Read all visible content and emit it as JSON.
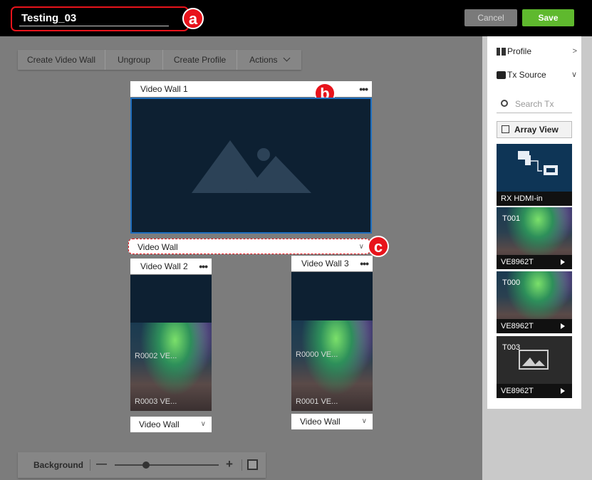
{
  "header": {
    "title": "Testing_03",
    "cancel_label": "Cancel",
    "save_label": "Save"
  },
  "callouts": {
    "a": "a",
    "b": "b",
    "c": "c"
  },
  "toolbar": {
    "items": [
      "Create Video Wall",
      "Ungroup",
      "Create Profile",
      "Actions"
    ]
  },
  "main_wall": {
    "title": "Video Wall 1",
    "menu": "•••",
    "select_value": "Video Wall"
  },
  "wall2": {
    "title": "Video Wall 2",
    "menu": "•••",
    "label_top": "R0002 VE...",
    "label_bottom": "R0003 VE...",
    "select_value": "Video Wall"
  },
  "wall3": {
    "title": "Video Wall 3",
    "menu": "•••",
    "label_top": "R0000 VE...",
    "label_bottom": "R0001 VE...",
    "select_value": "Video Wall"
  },
  "bottombar": {
    "label": "Background",
    "minus": "—",
    "plus": "+",
    "slider_level": 0.3
  },
  "right_panel": {
    "profile_label": "Profile",
    "tx_source_label": "Tx Source",
    "search_placeholder": "Search Tx",
    "array_view_label": "Array View",
    "tiles": [
      {
        "caption": "RX HDMI-in"
      },
      {
        "id": "T001",
        "caption": "VE8962T"
      },
      {
        "id": "T000",
        "caption": "VE8962T"
      },
      {
        "id": "T003",
        "caption": "VE8962T"
      }
    ]
  },
  "colors": {
    "accent_red": "#e8131b",
    "save_green": "#5fb92e",
    "screen_blue": "#0d2032",
    "selection_blue": "#1f6fbf"
  }
}
